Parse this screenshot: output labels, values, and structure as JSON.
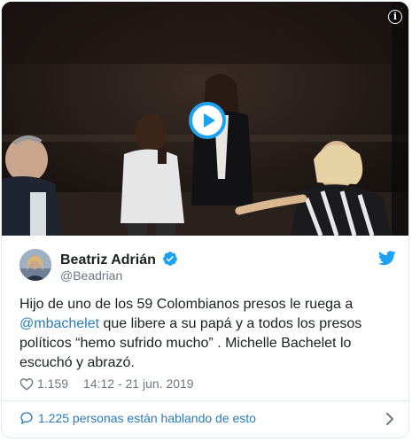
{
  "media": {
    "info_icon": "info-icon",
    "play_icon": "play-icon",
    "accent": "#1da1f2"
  },
  "author": {
    "name": "Beatriz Adrián",
    "handle": "@Beadrian",
    "verified": true
  },
  "tweet": {
    "text_before": "Hijo de uno de los 59 Colombianos presos le ruega a ",
    "mention": "@mbachelet",
    "text_after": " que libere a su papá y a todos los presos políticos “hemo sufrido mucho” . Michelle Bachelet lo escuchó y abrazó.",
    "likes": "1.159",
    "timestamp": "14:12 - 21 jun. 2019"
  },
  "footer": {
    "conversation": "1.225 personas están hablando de esto"
  },
  "colors": {
    "link": "#2b7bb9",
    "muted": "#697882",
    "text": "#1c2022",
    "twitter_blue": "#1da1f2"
  }
}
